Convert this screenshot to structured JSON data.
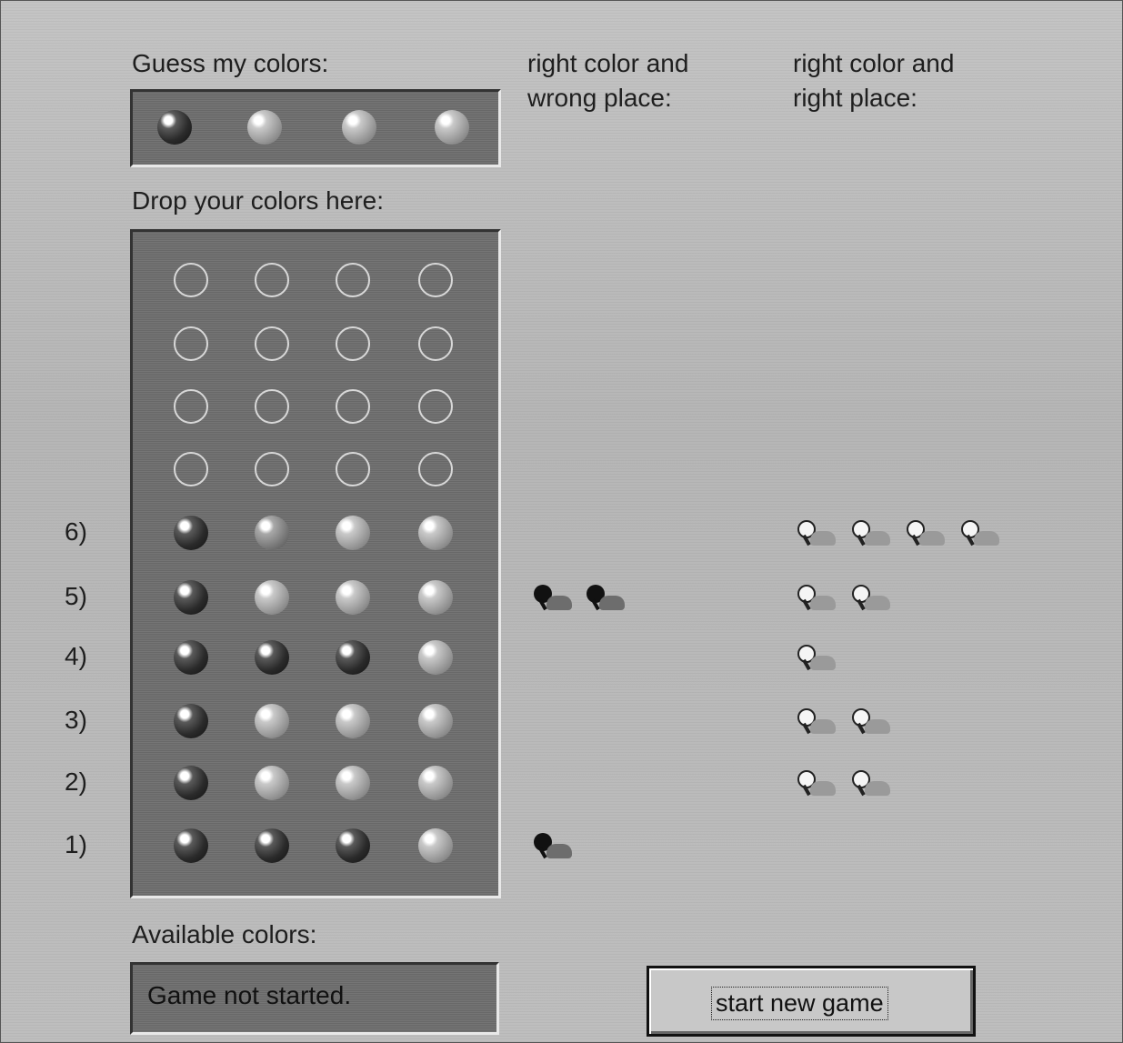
{
  "labels": {
    "guess": "Guess my colors:",
    "wrong_place_1": "right color and",
    "wrong_place_2": "wrong place:",
    "right_place_1": "right color and",
    "right_place_2": "right place:",
    "drop": "Drop your colors here:",
    "available": "Available colors:"
  },
  "secret_row": [
    "dark",
    "light",
    "light",
    "light"
  ],
  "board": {
    "empty_rows": 4,
    "rows": [
      {
        "number": "6)",
        "balls": [
          "dark",
          "light",
          "light",
          "light"
        ],
        "wrong_place": 0,
        "right_place": 4
      },
      {
        "number": "5)",
        "balls": [
          "dark",
          "light",
          "light",
          "light"
        ],
        "wrong_place": 2,
        "right_place": 2
      },
      {
        "number": "4)",
        "balls": [
          "dark",
          "dark",
          "dark",
          "light"
        ],
        "wrong_place": 0,
        "right_place": 1
      },
      {
        "number": "3)",
        "balls": [
          "dark",
          "light",
          "light",
          "light"
        ],
        "wrong_place": 0,
        "right_place": 2
      },
      {
        "number": "2)",
        "balls": [
          "dark",
          "light",
          "light",
          "light"
        ],
        "wrong_place": 0,
        "right_place": 2
      },
      {
        "number": "1)",
        "balls": [
          "dark",
          "dark",
          "dark",
          "light"
        ],
        "wrong_place": 1,
        "right_place": 0
      }
    ]
  },
  "status": "Game not started.",
  "start_button": "start new game",
  "colors": {
    "panel": "#6e6e6e",
    "background": "#b9b9b9"
  }
}
